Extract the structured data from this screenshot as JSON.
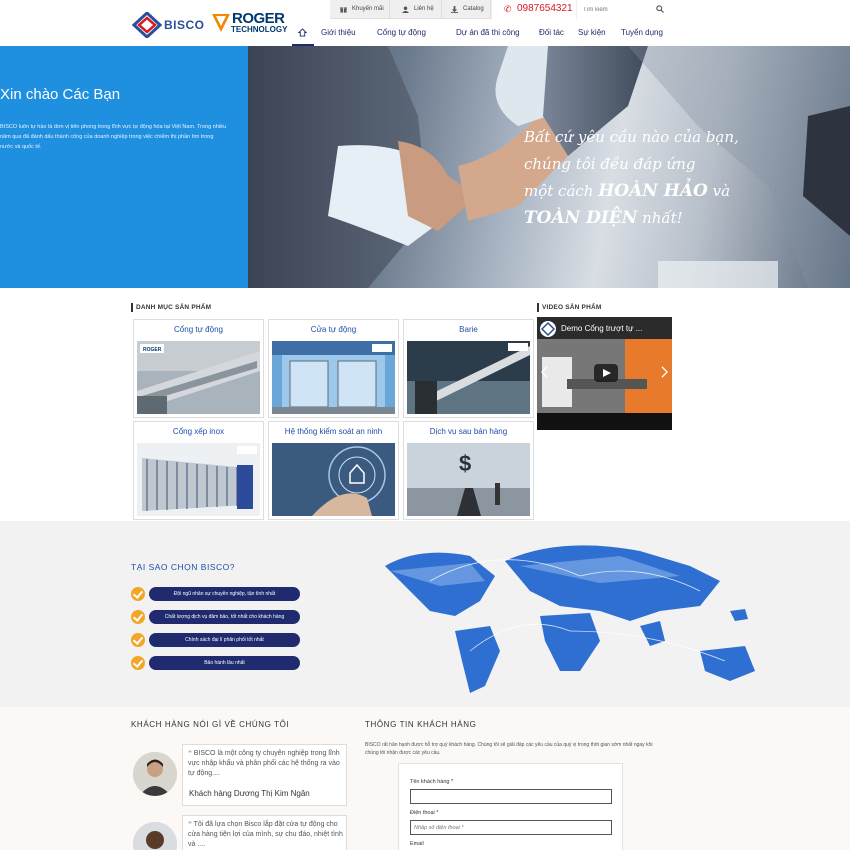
{
  "header": {
    "logo_bisco": "BISCO",
    "logo_roger": "ROGER",
    "logo_technology": "TECHNOLOGY",
    "topbar": {
      "promotions": "Khuyến mãi",
      "contact": "Liên hệ",
      "catalog": "Catalog",
      "phone": "0987654321",
      "search_placeholder": "Tìm kiếm"
    },
    "nav": [
      "Giới thiệu",
      "Cổng tự động",
      "Dự án đã thi công",
      "Đối tác",
      "Sự kiện",
      "Tuyển dụng"
    ]
  },
  "hero": {
    "title": "Xin chào Các Bạn",
    "description": "BISCO luôn tự hào là đơn vị tiên phong trong lĩnh vực tự động hóa tại Việt Nam. Trong nhiều năm qua đã đánh dấu thành công của doanh nghiệp trong việc chiếm thị phần tìm trong nước và quốc tế.",
    "slogan_line1": "Bất cứ yêu cầu nào của bạn,",
    "slogan_line2": "chúng tôi đều đáp ứng",
    "slogan_line3a": "một cách ",
    "slogan_line3b": "HOÀN HẢO",
    "slogan_line3c": " và",
    "slogan_line4a": "TOÀN DIỆN",
    "slogan_line4b": " nhất!"
  },
  "catalog": {
    "title": "DANH MỤC SẢN PHẨM",
    "items": [
      {
        "label": "Cổng tự động"
      },
      {
        "label": "Cửa tự động"
      },
      {
        "label": "Barie"
      },
      {
        "label": "Cổng xếp inox"
      },
      {
        "label": "Hệ thống kiểm soát an ninh"
      },
      {
        "label": "Dịch vụ sau bán hàng"
      }
    ],
    "roger_badge": "ROGER"
  },
  "video": {
    "title": "VIDEO SẢN PHẨM",
    "caption": "Demo Cổng trượt tự ..."
  },
  "why": {
    "title": "TẠI SAO CHỌN BISCO?",
    "items": [
      "Đội ngũ nhân sự chuyên nghiệp, tận tình nhất",
      "Chất lượng dịch vụ đảm bảo, tốt nhất cho khách hàng",
      "Chính sách đại lí phân phối tốt nhất",
      "Bảo hành lâu nhất"
    ]
  },
  "testimonials": {
    "title": "KHÁCH HÀNG NÓI GÌ VỀ CHÚNG TÔI",
    "items": [
      {
        "quote": "BISCO là một công ty chuyên nghiệp trong lĩnh vực nhập khẩu và phân phối các hệ thống ra vào tự động....",
        "name": "Khách hàng Dương Thị Kim Ngân"
      },
      {
        "quote": "Tôi đã lựa chọn Bisco lắp đặt cửa tự động cho cửa hàng tiện lợi của mình, sự chu đáo, nhiệt tình và ....",
        "name": ""
      }
    ]
  },
  "contact_form": {
    "title": "THÔNG TIN KHÁCH HÀNG",
    "description": "BISCO rất hân hạnh được hỗ trợ quý khách hàng. Chúng tôi sẽ giải đáp các yêu cầu của quý vị trong thời gian sớm nhất ngay khi chúng tôi nhận được các yêu cầu.",
    "name_label": "Tên khách hàng *",
    "phone_label": "Điện thoại *",
    "phone_placeholder": "Nhập số điện thoại *",
    "email_label": "Email"
  },
  "colors": {
    "brand_navy": "#1f2b6e",
    "hero_blue": "#1f8fe0",
    "accent_orange": "#f3a527",
    "phone_red": "#d71920"
  }
}
